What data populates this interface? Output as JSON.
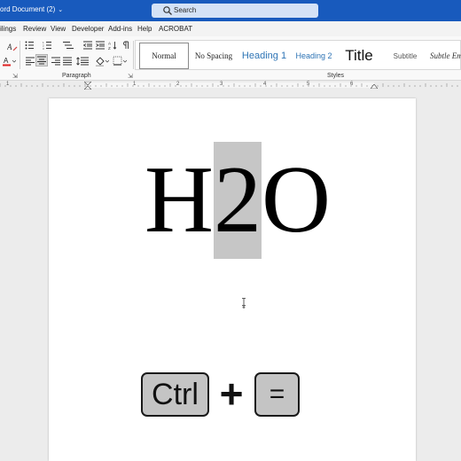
{
  "window": {
    "title": "ord Document (2)",
    "search_placeholder": "Search"
  },
  "menu": {
    "tabs": [
      "ilings",
      "Review",
      "View",
      "Developer",
      "Add-ins",
      "Help",
      "ACROBAT"
    ]
  },
  "ribbon": {
    "groups": {
      "paragraph_label": "Paragraph",
      "styles_label": "Styles"
    },
    "styles": [
      "Normal",
      "No Spacing",
      "Heading 1",
      "Heading 2",
      "Title",
      "Subtitle",
      "Subtle Em"
    ],
    "selected_style": "Normal"
  },
  "ruler": {
    "numbers": [
      "1",
      "1",
      "2",
      "3",
      "4",
      "5",
      "6"
    ]
  },
  "document": {
    "chars": [
      "H",
      "2",
      "O"
    ],
    "selected_char_index": 1,
    "shortcut": {
      "key1": "Ctrl",
      "plus": "+",
      "key2": "="
    }
  },
  "colors": {
    "title_bar": "#185abd",
    "selection": "#c6c6c6",
    "key_fill": "#c4c4c4"
  }
}
